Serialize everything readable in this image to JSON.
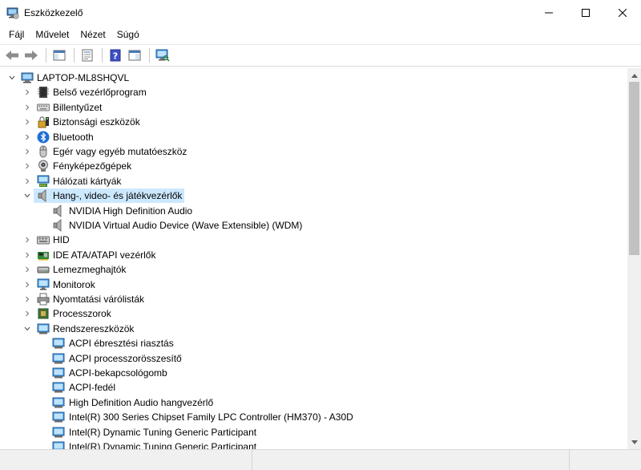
{
  "window": {
    "title": "Eszközkezelő"
  },
  "menu": [
    {
      "label": "Fájl"
    },
    {
      "label": "Művelet"
    },
    {
      "label": "Nézet"
    },
    {
      "label": "Súgó"
    }
  ],
  "toolbar": [
    {
      "icon": "back-icon"
    },
    {
      "icon": "forward-icon"
    },
    {
      "icon": "show-hide-console-tree-icon"
    },
    {
      "icon": "properties-icon"
    },
    {
      "icon": "help-icon"
    },
    {
      "icon": "show-action-pane-icon"
    },
    {
      "icon": "scan-hardware-changes-icon"
    }
  ],
  "tree": {
    "root": {
      "label": "LAPTOP-ML8SHQVL",
      "icon": "computer-icon",
      "expanded": true
    },
    "rows": [
      {
        "label": "Belső vezérlőprogram",
        "icon": "firmware-icon",
        "level": 1,
        "chevron": "collapsed"
      },
      {
        "label": "Billentyűzet",
        "icon": "keyboard-icon",
        "level": 1,
        "chevron": "collapsed"
      },
      {
        "label": "Biztonsági eszközök",
        "icon": "security-device-icon",
        "level": 1,
        "chevron": "collapsed"
      },
      {
        "label": "Bluetooth",
        "icon": "bluetooth-icon",
        "level": 1,
        "chevron": "collapsed"
      },
      {
        "label": "Egér vagy egyéb mutatóeszköz",
        "icon": "mouse-icon",
        "level": 1,
        "chevron": "collapsed"
      },
      {
        "label": "Fényképezőgépek",
        "icon": "camera-icon",
        "level": 1,
        "chevron": "collapsed"
      },
      {
        "label": "Hálózati kártyák",
        "icon": "network-adapter-icon",
        "level": 1,
        "chevron": "collapsed"
      },
      {
        "label": "Hang-, video- és játékvezérlők",
        "icon": "speaker-icon",
        "level": 1,
        "chevron": "expanded",
        "selected": true
      },
      {
        "label": "NVIDIA High Definition Audio",
        "icon": "speaker-icon",
        "level": 2,
        "chevron": "none"
      },
      {
        "label": "NVIDIA Virtual Audio Device (Wave Extensible) (WDM)",
        "icon": "speaker-icon",
        "level": 2,
        "chevron": "none"
      },
      {
        "label": "HID",
        "icon": "hid-icon",
        "level": 1,
        "chevron": "collapsed"
      },
      {
        "label": "IDE ATA/ATAPI vezérlők",
        "icon": "ide-controller-icon",
        "level": 1,
        "chevron": "collapsed"
      },
      {
        "label": "Lemezmeghajtók",
        "icon": "disk-drive-icon",
        "level": 1,
        "chevron": "collapsed"
      },
      {
        "label": "Monitorok",
        "icon": "monitor-icon",
        "level": 1,
        "chevron": "collapsed"
      },
      {
        "label": "Nyomtatási várólisták",
        "icon": "printer-icon",
        "level": 1,
        "chevron": "collapsed"
      },
      {
        "label": "Processzorok",
        "icon": "processor-icon",
        "level": 1,
        "chevron": "collapsed"
      },
      {
        "label": "Rendszereszközök",
        "icon": "system-device-icon",
        "level": 1,
        "chevron": "expanded"
      },
      {
        "label": "ACPI ébresztési riasztás",
        "icon": "system-device-icon",
        "level": 2,
        "chevron": "none"
      },
      {
        "label": "ACPI processzorösszesítő",
        "icon": "system-device-icon",
        "level": 2,
        "chevron": "none"
      },
      {
        "label": "ACPI-bekapcsológomb",
        "icon": "system-device-icon",
        "level": 2,
        "chevron": "none"
      },
      {
        "label": "ACPI-fedél",
        "icon": "system-device-icon",
        "level": 2,
        "chevron": "none"
      },
      {
        "label": "High Definition Audio hangvezérlő",
        "icon": "system-device-icon",
        "level": 2,
        "chevron": "none"
      },
      {
        "label": "Intel(R) 300 Series Chipset Family LPC Controller (HM370) - A30D",
        "icon": "system-device-icon",
        "level": 2,
        "chevron": "none"
      },
      {
        "label": "Intel(R) Dynamic Tuning Generic Participant",
        "icon": "system-device-icon",
        "level": 2,
        "chevron": "none"
      },
      {
        "label": "Intel(R) Dynamic Tuning Generic Participant",
        "icon": "system-device-icon",
        "level": 2,
        "chevron": "none"
      }
    ]
  },
  "colors": {
    "selection": "#cce8ff",
    "accent": "#0078d7"
  }
}
